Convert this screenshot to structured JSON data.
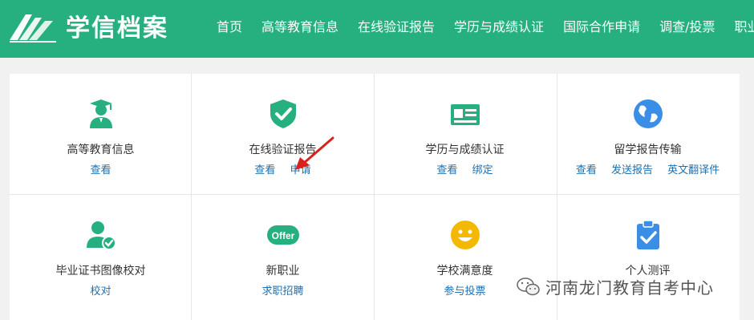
{
  "header": {
    "brand": "学信档案",
    "nav": [
      "首页",
      "高等教育信息",
      "在线验证报告",
      "学历与成绩认证",
      "国际合作申请",
      "调查/投票",
      "职业"
    ]
  },
  "cards": [
    {
      "icon": "graduate-icon",
      "title": "高等教育信息",
      "links": [
        "查看"
      ]
    },
    {
      "icon": "shield-check-icon",
      "title": "在线验证报告",
      "links": [
        "查看",
        "申请"
      ]
    },
    {
      "icon": "id-card-icon",
      "title": "学历与成绩认证",
      "links": [
        "查看",
        "绑定"
      ]
    },
    {
      "icon": "globe-icon",
      "title": "留学报告传输",
      "links": [
        "查看",
        "发送报告",
        "英文翻译件"
      ]
    },
    {
      "icon": "user-check-icon",
      "title": "毕业证书图像校对",
      "links": [
        "校对"
      ]
    },
    {
      "icon": "offer-icon",
      "title": "新职业",
      "links": [
        "求职招聘"
      ],
      "badge": "Offer"
    },
    {
      "icon": "smiley-icon",
      "title": "学校满意度",
      "links": [
        "参与投票"
      ]
    },
    {
      "icon": "clipboard-check-icon",
      "title": "个人测评",
      "links": []
    }
  ],
  "watermark": "河南龙门教育自考中心",
  "colors": {
    "brand": "#27b07f",
    "link": "#1e6fb0",
    "globe": "#3a8ee6",
    "smiley": "#f5b800",
    "clipboard": "#3a8ee6",
    "arrow": "#d8231c"
  }
}
